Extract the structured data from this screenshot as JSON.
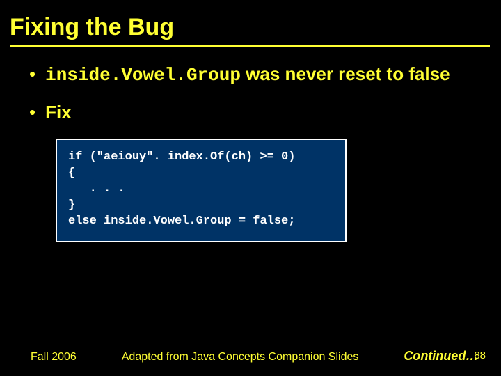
{
  "title": "Fixing the Bug",
  "bullets": [
    {
      "code": "inside.Vowel.Group",
      "rest": " was never reset to false"
    },
    {
      "text": "Fix"
    }
  ],
  "code": "if (\"aeiouy\". index.Of(ch) >= 0)\n{\n   . . .\n}\nelse inside.Vowel.Group = false;",
  "footer": {
    "left": "Fall 2006",
    "center": "Adapted from Java Concepts Companion Slides",
    "continued": "Continued…",
    "page": "88"
  }
}
